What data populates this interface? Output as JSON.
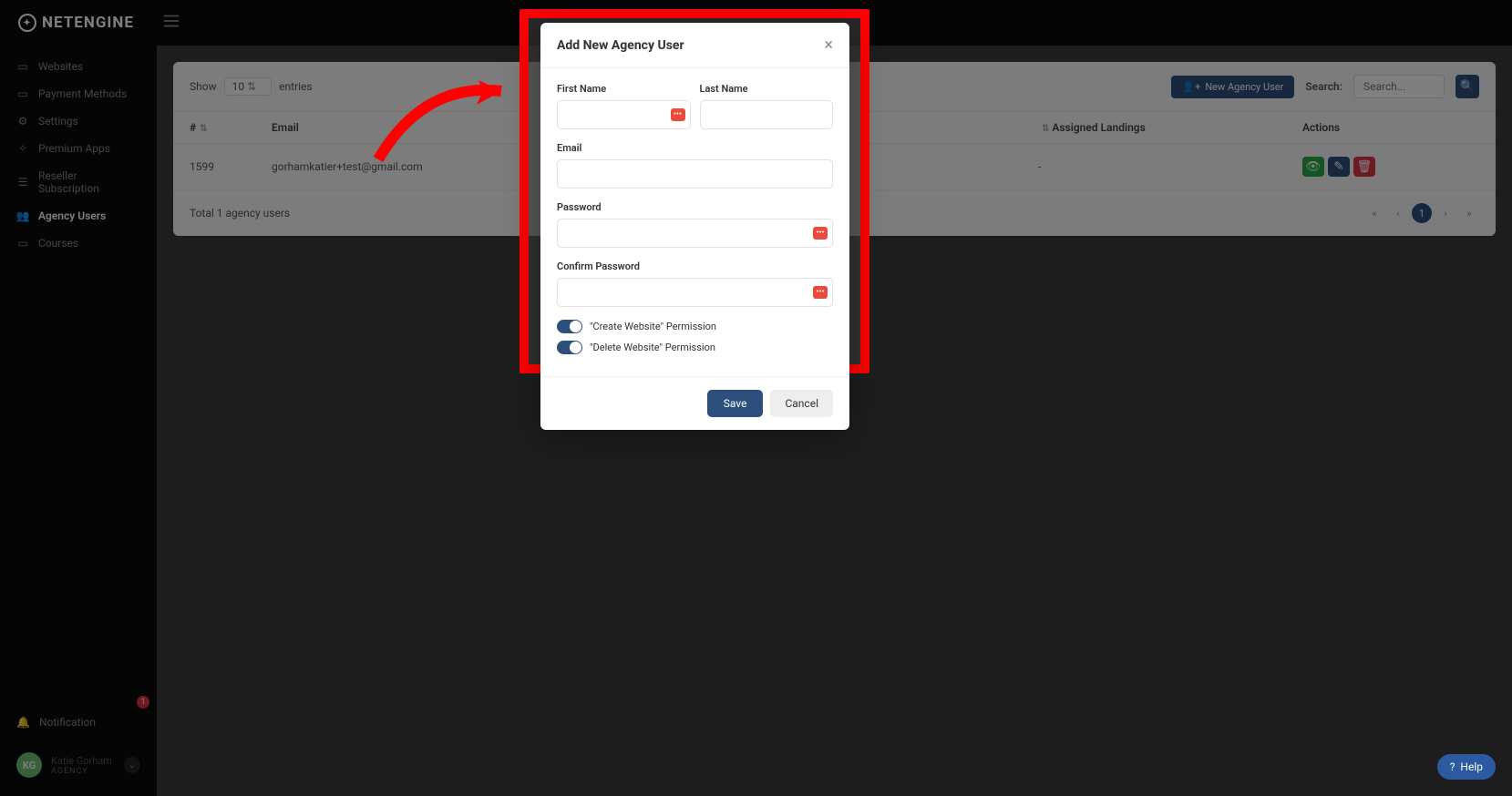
{
  "brand": "NETENGINE",
  "sidebar": {
    "items": [
      {
        "label": "Websites"
      },
      {
        "label": "Payment Methods"
      },
      {
        "label": "Settings"
      },
      {
        "label": "Premium Apps"
      },
      {
        "label": "Reseller Subscription"
      },
      {
        "label": "Agency Users"
      },
      {
        "label": "Courses"
      }
    ]
  },
  "notification": {
    "label": "Notification",
    "badge": "1"
  },
  "user": {
    "initials": "KG",
    "name": "Katie Gorham",
    "role": "AGENCY"
  },
  "toolbar": {
    "show_label": "Show",
    "entries_value": "10",
    "entries_label": "entries",
    "new_button": "New Agency User",
    "search_label": "Search:",
    "search_placeholder": "Search..."
  },
  "table": {
    "headers": {
      "id": "#",
      "email": "Email",
      "landings": "Assigned Landings",
      "actions": "Actions"
    },
    "row": {
      "id": "1599",
      "email": "gorhamkatier+test@gmail.com",
      "landings": "-"
    }
  },
  "footer_text": "Total 1 agency users",
  "pagination": {
    "current": "1"
  },
  "modal": {
    "title": "Add New Agency User",
    "first_name": "First Name",
    "last_name": "Last Name",
    "email": "Email",
    "password": "Password",
    "confirm_password": "Confirm Password",
    "perm_create": "\"Create Website\" Permission",
    "perm_delete": "\"Delete Website\" Permission",
    "save": "Save",
    "cancel": "Cancel"
  },
  "help": "Help"
}
